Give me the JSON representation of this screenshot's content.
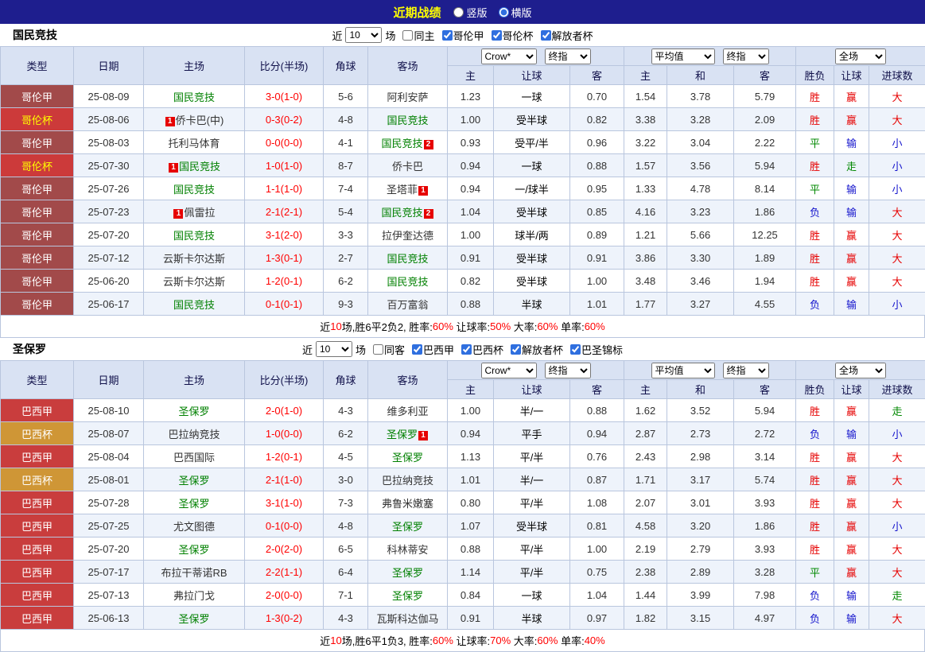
{
  "topbar": {
    "title": "近期战绩",
    "radios": [
      {
        "label": "竖版",
        "checked": false
      },
      {
        "label": "横版",
        "checked": true
      }
    ]
  },
  "table_header": {
    "cols": [
      "类型",
      "日期",
      "主场",
      "比分(半场)",
      "角球",
      "客场"
    ],
    "crow_select": "Crow*",
    "final_select": "终指",
    "avg_select": "平均值",
    "scope_select": "全场",
    "odds_sub": [
      "主",
      "让球",
      "客"
    ],
    "avg_sub": [
      "主",
      "和",
      "客"
    ],
    "result_cols": [
      "胜负",
      "让球",
      "进球数"
    ]
  },
  "colors": {
    "win": "#e60000",
    "draw": "#008800",
    "lose": "#1414cc",
    "score": "#ff0000",
    "focus_team": "#008000",
    "league": {
      "哥伦甲": [
        "#a24a4a",
        "#ffffff"
      ],
      "哥伦杯": [
        "#cc3a3a",
        "#ffff00"
      ],
      "巴西甲": [
        "#c93d3d",
        "#ffffff"
      ],
      "巴西杯": [
        "#cf9636",
        "#ffffff"
      ]
    }
  },
  "sections": [
    {
      "team": "国民竞技",
      "filter": {
        "near_label": "近",
        "count": "10",
        "games_label": "场",
        "same_label": "同主",
        "same_checked": false,
        "leagues": [
          {
            "label": "哥伦甲",
            "checked": true
          },
          {
            "label": "哥伦杯",
            "checked": true
          },
          {
            "label": "解放者杯",
            "checked": true
          }
        ]
      },
      "rows": [
        {
          "league": "哥伦甲",
          "date": "25-08-09",
          "home": {
            "text": "国民竞技",
            "green": true
          },
          "score": "3-0(1-0)",
          "corner": "5-6",
          "away": {
            "text": "阿利安萨"
          },
          "odds": [
            "1.23",
            "一球",
            "0.70"
          ],
          "avg": [
            "1.54",
            "3.78",
            "5.79"
          ],
          "res": [
            "胜",
            "赢",
            "大"
          ]
        },
        {
          "league": "哥伦杯",
          "date": "25-08-06",
          "home": {
            "text": "侨卡巴(中)",
            "pre": "1"
          },
          "score": "0-3(0-2)",
          "corner": "4-8",
          "away": {
            "text": "国民竞技",
            "green": true
          },
          "odds": [
            "1.00",
            "受半球",
            "0.82"
          ],
          "avg": [
            "3.38",
            "3.28",
            "2.09"
          ],
          "res": [
            "胜",
            "赢",
            "大"
          ]
        },
        {
          "league": "哥伦甲",
          "date": "25-08-03",
          "home": {
            "text": "托利马体育"
          },
          "score": "0-0(0-0)",
          "corner": "4-1",
          "away": {
            "text": "国民竞技",
            "green": true,
            "post": "2"
          },
          "odds": [
            "0.93",
            "受平/半",
            "0.96"
          ],
          "avg": [
            "3.22",
            "3.04",
            "2.22"
          ],
          "res": [
            "平",
            "输",
            "小"
          ]
        },
        {
          "league": "哥伦杯",
          "date": "25-07-30",
          "home": {
            "text": "国民竞技",
            "green": true,
            "pre": "1"
          },
          "score": "1-0(1-0)",
          "corner": "8-7",
          "away": {
            "text": "侨卡巴"
          },
          "odds": [
            "0.94",
            "一球",
            "0.88"
          ],
          "avg": [
            "1.57",
            "3.56",
            "5.94"
          ],
          "res": [
            "胜",
            "走",
            "小"
          ]
        },
        {
          "league": "哥伦甲",
          "date": "25-07-26",
          "home": {
            "text": "国民竞技",
            "green": true
          },
          "score": "1-1(1-0)",
          "corner": "7-4",
          "away": {
            "text": "圣塔菲",
            "post": "1"
          },
          "odds": [
            "0.94",
            "一/球半",
            "0.95"
          ],
          "avg": [
            "1.33",
            "4.78",
            "8.14"
          ],
          "res": [
            "平",
            "输",
            "小"
          ]
        },
        {
          "league": "哥伦甲",
          "date": "25-07-23",
          "home": {
            "text": "佩雷拉",
            "pre": "1"
          },
          "score": "2-1(2-1)",
          "corner": "5-4",
          "away": {
            "text": "国民竞技",
            "green": true,
            "post": "2"
          },
          "odds": [
            "1.04",
            "受半球",
            "0.85"
          ],
          "avg": [
            "4.16",
            "3.23",
            "1.86"
          ],
          "res": [
            "负",
            "输",
            "大"
          ]
        },
        {
          "league": "哥伦甲",
          "date": "25-07-20",
          "home": {
            "text": "国民竞技",
            "green": true
          },
          "score": "3-1(2-0)",
          "corner": "3-3",
          "away": {
            "text": "拉伊奎达德"
          },
          "odds": [
            "1.00",
            "球半/两",
            "0.89"
          ],
          "avg": [
            "1.21",
            "5.66",
            "12.25"
          ],
          "res": [
            "胜",
            "赢",
            "大"
          ]
        },
        {
          "league": "哥伦甲",
          "date": "25-07-12",
          "home": {
            "text": "云斯卡尔达斯"
          },
          "score": "1-3(0-1)",
          "corner": "2-7",
          "away": {
            "text": "国民竞技",
            "green": true
          },
          "odds": [
            "0.91",
            "受半球",
            "0.91"
          ],
          "avg": [
            "3.86",
            "3.30",
            "1.89"
          ],
          "res": [
            "胜",
            "赢",
            "大"
          ]
        },
        {
          "league": "哥伦甲",
          "date": "25-06-20",
          "home": {
            "text": "云斯卡尔达斯"
          },
          "score": "1-2(0-1)",
          "corner": "6-2",
          "away": {
            "text": "国民竞技",
            "green": true
          },
          "odds": [
            "0.82",
            "受半球",
            "1.00"
          ],
          "avg": [
            "3.48",
            "3.46",
            "1.94"
          ],
          "res": [
            "胜",
            "赢",
            "大"
          ]
        },
        {
          "league": "哥伦甲",
          "date": "25-06-17",
          "home": {
            "text": "国民竞技",
            "green": true
          },
          "score": "0-1(0-1)",
          "corner": "9-3",
          "away": {
            "text": "百万富翁"
          },
          "odds": [
            "0.88",
            "半球",
            "1.01"
          ],
          "avg": [
            "1.77",
            "3.27",
            "4.55"
          ],
          "res": [
            "负",
            "输",
            "小"
          ]
        }
      ],
      "summary": [
        {
          "t": "近"
        },
        {
          "t": "10",
          "red": true
        },
        {
          "t": "场,胜6平2负2, 胜率:"
        },
        {
          "t": "60%",
          "red": true
        },
        {
          "t": " 让球率:"
        },
        {
          "t": "50%",
          "red": true
        },
        {
          "t": " 大率:"
        },
        {
          "t": "60%",
          "red": true
        },
        {
          "t": " 单率:"
        },
        {
          "t": "60%",
          "red": true
        }
      ]
    },
    {
      "team": "圣保罗",
      "filter": {
        "near_label": "近",
        "count": "10",
        "games_label": "场",
        "same_label": "同客",
        "same_checked": false,
        "leagues": [
          {
            "label": "巴西甲",
            "checked": true
          },
          {
            "label": "巴西杯",
            "checked": true
          },
          {
            "label": "解放者杯",
            "checked": true
          },
          {
            "label": "巴圣锦标",
            "checked": true
          }
        ]
      },
      "rows": [
        {
          "league": "巴西甲",
          "date": "25-08-10",
          "home": {
            "text": "圣保罗",
            "green": true
          },
          "score": "2-0(1-0)",
          "corner": "4-3",
          "away": {
            "text": "维多利亚"
          },
          "odds": [
            "1.00",
            "半/一",
            "0.88"
          ],
          "avg": [
            "1.62",
            "3.52",
            "5.94"
          ],
          "res": [
            "胜",
            "赢",
            "走"
          ]
        },
        {
          "league": "巴西杯",
          "date": "25-08-07",
          "home": {
            "text": "巴拉纳竞技"
          },
          "score": "1-0(0-0)",
          "corner": "6-2",
          "away": {
            "text": "圣保罗",
            "green": true,
            "post": "1"
          },
          "odds": [
            "0.94",
            "平手",
            "0.94"
          ],
          "avg": [
            "2.87",
            "2.73",
            "2.72"
          ],
          "res": [
            "负",
            "输",
            "小"
          ]
        },
        {
          "league": "巴西甲",
          "date": "25-08-04",
          "home": {
            "text": "巴西国际"
          },
          "score": "1-2(0-1)",
          "corner": "4-5",
          "away": {
            "text": "圣保罗",
            "green": true
          },
          "odds": [
            "1.13",
            "平/半",
            "0.76"
          ],
          "avg": [
            "2.43",
            "2.98",
            "3.14"
          ],
          "res": [
            "胜",
            "赢",
            "大"
          ]
        },
        {
          "league": "巴西杯",
          "date": "25-08-01",
          "home": {
            "text": "圣保罗",
            "green": true
          },
          "score": "2-1(1-0)",
          "corner": "3-0",
          "away": {
            "text": "巴拉纳竞技"
          },
          "odds": [
            "1.01",
            "半/一",
            "0.87"
          ],
          "avg": [
            "1.71",
            "3.17",
            "5.74"
          ],
          "res": [
            "胜",
            "赢",
            "大"
          ]
        },
        {
          "league": "巴西甲",
          "date": "25-07-28",
          "home": {
            "text": "圣保罗",
            "green": true
          },
          "score": "3-1(1-0)",
          "corner": "7-3",
          "away": {
            "text": "弗鲁米嫩塞"
          },
          "odds": [
            "0.80",
            "平/半",
            "1.08"
          ],
          "avg": [
            "2.07",
            "3.01",
            "3.93"
          ],
          "res": [
            "胜",
            "赢",
            "大"
          ]
        },
        {
          "league": "巴西甲",
          "date": "25-07-25",
          "home": {
            "text": "尤文图德"
          },
          "score": "0-1(0-0)",
          "corner": "4-8",
          "away": {
            "text": "圣保罗",
            "green": true
          },
          "odds": [
            "1.07",
            "受半球",
            "0.81"
          ],
          "avg": [
            "4.58",
            "3.20",
            "1.86"
          ],
          "res": [
            "胜",
            "赢",
            "小"
          ]
        },
        {
          "league": "巴西甲",
          "date": "25-07-20",
          "home": {
            "text": "圣保罗",
            "green": true
          },
          "score": "2-0(2-0)",
          "corner": "6-5",
          "away": {
            "text": "科林蒂安"
          },
          "odds": [
            "0.88",
            "平/半",
            "1.00"
          ],
          "avg": [
            "2.19",
            "2.79",
            "3.93"
          ],
          "res": [
            "胜",
            "赢",
            "大"
          ]
        },
        {
          "league": "巴西甲",
          "date": "25-07-17",
          "home": {
            "text": "布拉干蒂诺RB"
          },
          "score": "2-2(1-1)",
          "corner": "6-4",
          "away": {
            "text": "圣保罗",
            "green": true
          },
          "odds": [
            "1.14",
            "平/半",
            "0.75"
          ],
          "avg": [
            "2.38",
            "2.89",
            "3.28"
          ],
          "res": [
            "平",
            "赢",
            "大"
          ]
        },
        {
          "league": "巴西甲",
          "date": "25-07-13",
          "home": {
            "text": "弗拉门戈"
          },
          "score": "2-0(0-0)",
          "corner": "7-1",
          "away": {
            "text": "圣保罗",
            "green": true
          },
          "odds": [
            "0.84",
            "一球",
            "1.04"
          ],
          "avg": [
            "1.44",
            "3.99",
            "7.98"
          ],
          "res": [
            "负",
            "输",
            "走"
          ]
        },
        {
          "league": "巴西甲",
          "date": "25-06-13",
          "home": {
            "text": "圣保罗",
            "green": true
          },
          "score": "1-3(0-2)",
          "corner": "4-3",
          "away": {
            "text": "瓦斯科达伽马"
          },
          "odds": [
            "0.91",
            "半球",
            "0.97"
          ],
          "avg": [
            "1.82",
            "3.15",
            "4.97"
          ],
          "res": [
            "负",
            "输",
            "大"
          ]
        }
      ],
      "summary": [
        {
          "t": "近"
        },
        {
          "t": "10",
          "red": true
        },
        {
          "t": "场,胜6平1负3, 胜率:"
        },
        {
          "t": "60%",
          "red": true
        },
        {
          "t": " 让球率:"
        },
        {
          "t": "70%",
          "red": true
        },
        {
          "t": " 大率:"
        },
        {
          "t": "60%",
          "red": true
        },
        {
          "t": " 单率:"
        },
        {
          "t": "40%",
          "red": true
        }
      ]
    }
  ]
}
